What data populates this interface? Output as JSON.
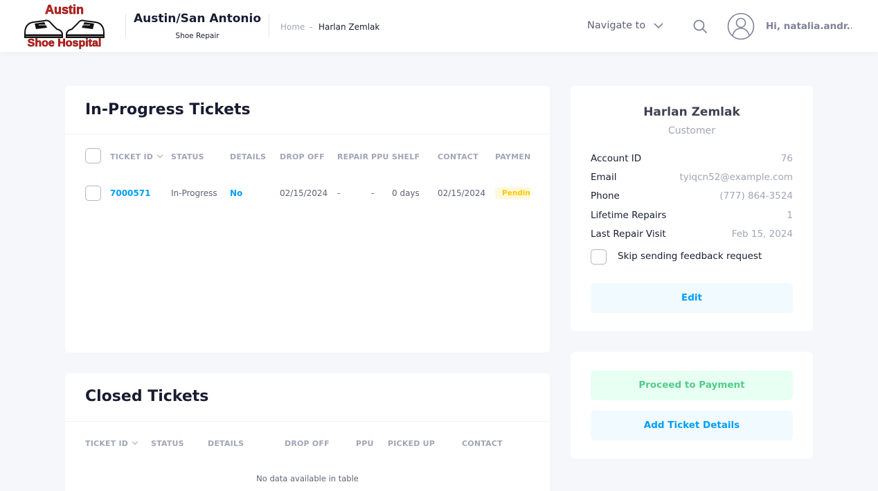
{
  "header": {
    "logo_line1": "Austin",
    "logo_line2": "Shoe Hospital",
    "brand_title": "Austin/San Antonio",
    "brand_subtitle": "Shoe Repair",
    "breadcrumb": {
      "home": "Home",
      "separator": "-",
      "current": "Harlan Zemlak"
    },
    "navigate_label": "Navigate to",
    "greeting": "Hi, natalia.andr...!"
  },
  "in_progress": {
    "title": "In-Progress Tickets",
    "columns": [
      "TICKET ID",
      "STATUS",
      "DETAILS",
      "DROP OFF",
      "REPAIR",
      "PPU",
      "SHELF",
      "CONTACT",
      "PAYMEN"
    ],
    "rows": [
      {
        "ticket_id": "7000571",
        "status": "In-Progress",
        "details": "No",
        "drop_off": "02/15/2024",
        "repair": "-",
        "ppu": "-",
        "shelf": "0 days",
        "contact": "02/15/2024",
        "payment": "Pending"
      }
    ]
  },
  "closed": {
    "title": "Closed Tickets",
    "columns": [
      "TICKET ID",
      "STATUS",
      "DETAILS",
      "DROP OFF",
      "PPU",
      "PICKED UP",
      "CONTACT"
    ],
    "empty_message": "No data available in table"
  },
  "customer": {
    "name": "Harlan Zemlak",
    "role": "Customer",
    "fields": [
      {
        "label": "Account ID",
        "value": "76"
      },
      {
        "label": "Email",
        "value": "tyiqcn52@example.com"
      },
      {
        "label": "Phone",
        "value": "(777) 864-3524"
      },
      {
        "label": "Lifetime Repairs",
        "value": "1"
      },
      {
        "label": "Last Repair Visit",
        "value": "Feb 15, 2024"
      }
    ],
    "skip_feedback_label": "Skip sending feedback request",
    "edit_label": "Edit"
  },
  "actions": {
    "proceed_label": "Proceed to Payment",
    "add_details_label": "Add Ticket Details"
  },
  "colors": {
    "primary": "#009ef7",
    "success": "#50cd89",
    "warning": "#ffc700",
    "logo_red": "#e0201b"
  },
  "icons": [
    "logo-shoes-icon",
    "chevron-down-icon",
    "search-icon",
    "user-avatar-icon",
    "sort-chevron-icon"
  ]
}
